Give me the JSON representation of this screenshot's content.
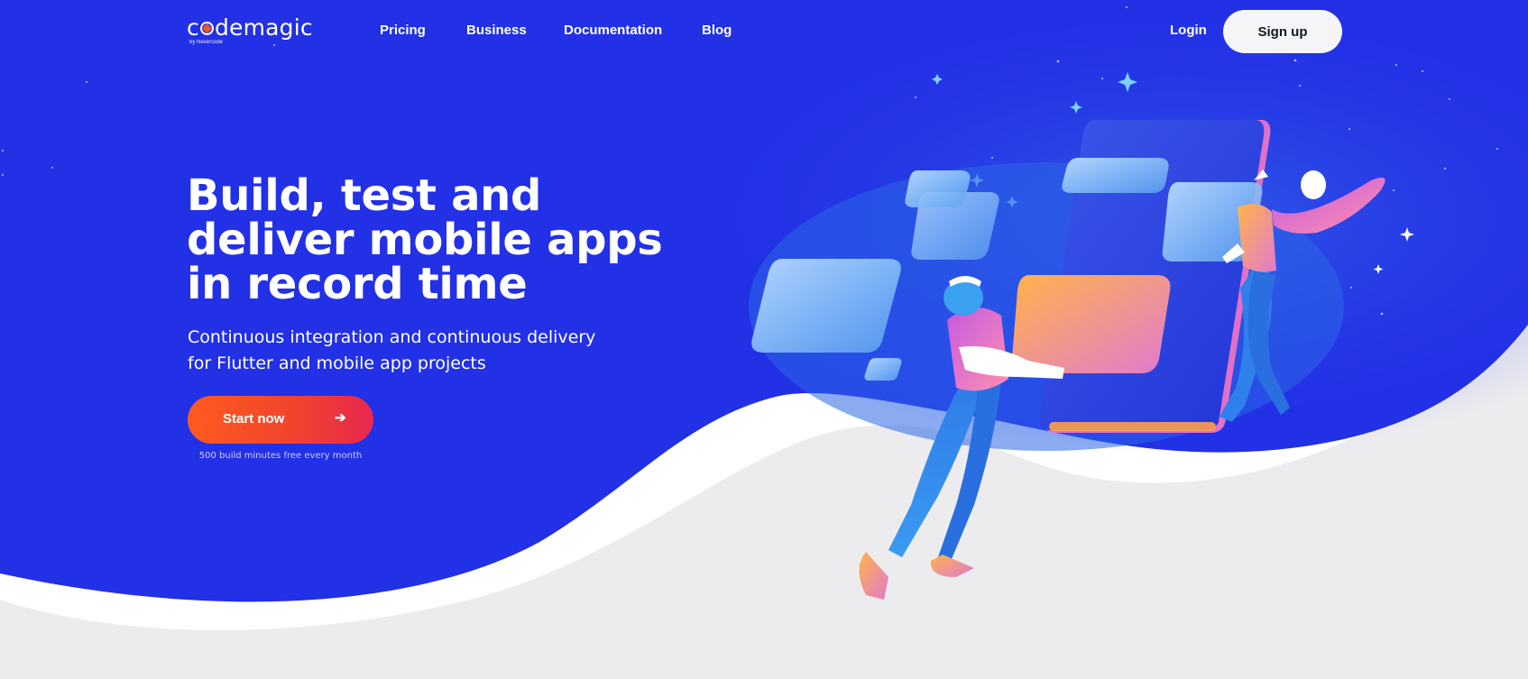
{
  "brand": {
    "logo_text_before": "c",
    "logo_text_after": "demagic",
    "logo_sub": "by Nevercode"
  },
  "nav": {
    "items": [
      {
        "label": "Pricing"
      },
      {
        "label": "Business"
      },
      {
        "label": "Documentation"
      },
      {
        "label": "Blog"
      }
    ],
    "login_label": "Login",
    "signup_label": "Sign up"
  },
  "hero": {
    "title": "Build, test and deliver mobile apps in record time",
    "subtitle_line1": "Continuous integration and continuous delivery",
    "subtitle_line2": "for Flutter and mobile app projects",
    "cta_label": "Start now",
    "cta_icon": "arrow-right-icon",
    "cta_note": "500 build minutes free every month"
  },
  "colors": {
    "background_blue": "#2230e6",
    "cta_gradient_start": "#ff5b1f",
    "cta_gradient_end": "#e8284f",
    "logo_accent": "#f0532b",
    "signup_bg": "#f5f5f7"
  }
}
